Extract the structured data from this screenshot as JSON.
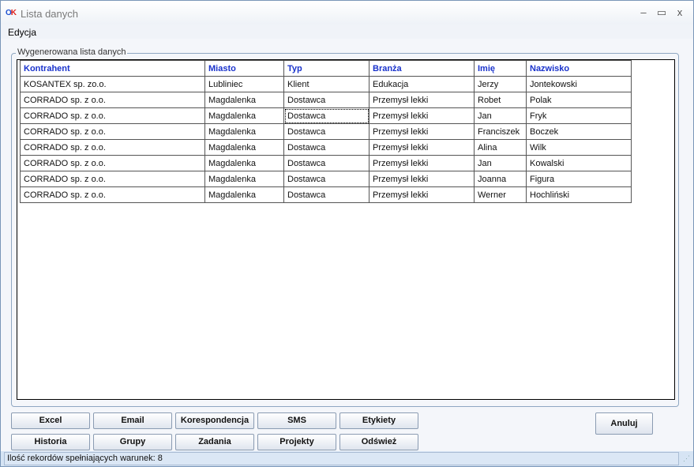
{
  "window": {
    "title": "Lista danych",
    "logo_o": "O",
    "logo_k": "K",
    "minimize_glyph": "–",
    "maximize_glyph": "▭",
    "close_glyph": "x"
  },
  "menu": {
    "edycja": "Edycja"
  },
  "group": {
    "legend": "Wygenerowana lista danych"
  },
  "table": {
    "headers": [
      "Kontrahent",
      "Miasto",
      "Typ",
      "Branża",
      "Imię",
      "Nazwisko"
    ],
    "rows": [
      [
        "KOSANTEX sp. zo.o.",
        "Lubliniec",
        "Klient",
        "Edukacja",
        "Jerzy",
        "Jontekowski"
      ],
      [
        "CORRADO sp. z o.o.",
        "Magdalenka",
        "Dostawca",
        "Przemysł lekki",
        "Robet",
        "Polak"
      ],
      [
        "CORRADO sp. z o.o.",
        "Magdalenka",
        "Dostawca",
        "Przemysł lekki",
        "Jan",
        "Fryk"
      ],
      [
        "CORRADO sp. z o.o.",
        "Magdalenka",
        "Dostawca",
        "Przemysł lekki",
        "Franciszek",
        "Boczek"
      ],
      [
        "CORRADO sp. z o.o.",
        "Magdalenka",
        "Dostawca",
        "Przemysł lekki",
        "Alina",
        "Wilk"
      ],
      [
        "CORRADO sp. z o.o.",
        "Magdalenka",
        "Dostawca",
        "Przemysł lekki",
        "Jan",
        "Kowalski"
      ],
      [
        "CORRADO sp. z o.o.",
        "Magdalenka",
        "Dostawca",
        "Przemysł lekki",
        "Joanna",
        "Figura"
      ],
      [
        "CORRADO sp. z o.o.",
        "Magdalenka",
        "Dostawca",
        "Przemysł lekki",
        "Werner",
        "Hochliński"
      ]
    ]
  },
  "buttons": {
    "excel": "Excel",
    "email": "Email",
    "korespondencja": "Korespondencja",
    "sms": "SMS",
    "etykiety": "Etykiety",
    "historia": "Historia",
    "grupy": "Grupy",
    "zadania": "Zadania",
    "projekty": "Projekty",
    "odswiez": "Odśwież",
    "anuluj": "Anuluj"
  },
  "status": {
    "text": "Ilość rekordów spełniających warunek: 8"
  }
}
